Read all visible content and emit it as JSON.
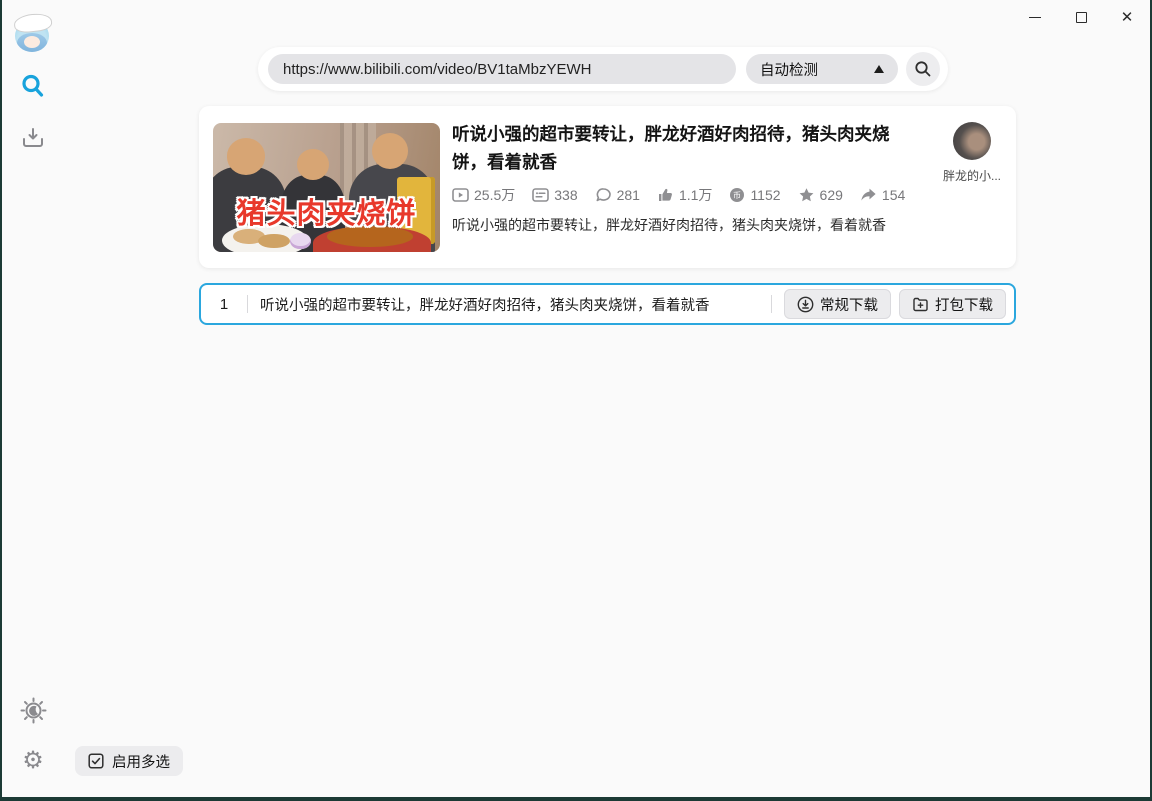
{
  "app": {
    "accent_blue": "#18a3dc",
    "selection_border_blue": "#2ba7de",
    "edge_color": "#1c3a35"
  },
  "titlebar": {
    "close_icon_glyph": "✕"
  },
  "searchbar": {
    "url_value": "https://www.bilibili.com/video/BV1taMbzYEWH",
    "detect_label": "自动检测"
  },
  "video": {
    "title": "听说小强的超市要转让，胖龙好酒好肉招待，猪头肉夹烧饼，看着就香",
    "thumbnail_caption": "猪头肉夹烧饼",
    "stats": [
      {
        "icon": "play-count-icon",
        "value": "25.5万"
      },
      {
        "icon": "danmaku-icon",
        "value": "338"
      },
      {
        "icon": "comment-icon",
        "value": "281"
      },
      {
        "icon": "like-icon",
        "value": "1.1万"
      },
      {
        "icon": "coin-icon",
        "value": "1152"
      },
      {
        "icon": "favorite-icon",
        "value": "629"
      },
      {
        "icon": "share-icon",
        "value": "154"
      }
    ],
    "description": "听说小强的超市要转让，胖龙好酒好肉招待，猪头肉夹烧饼，看着就香",
    "uploader_name": "胖龙的小...",
    "coin_glyph": "币"
  },
  "selection_row": {
    "index": "1",
    "title": "听说小强的超市要转让，胖龙好酒好肉招待，猪头肉夹烧饼，看着就香",
    "buttons": [
      {
        "icon": "download-circle-icon",
        "label": "常规下载"
      },
      {
        "icon": "package-add-icon",
        "label": "打包下载"
      }
    ]
  },
  "footer": {
    "multi_select_label": "启用多选"
  }
}
